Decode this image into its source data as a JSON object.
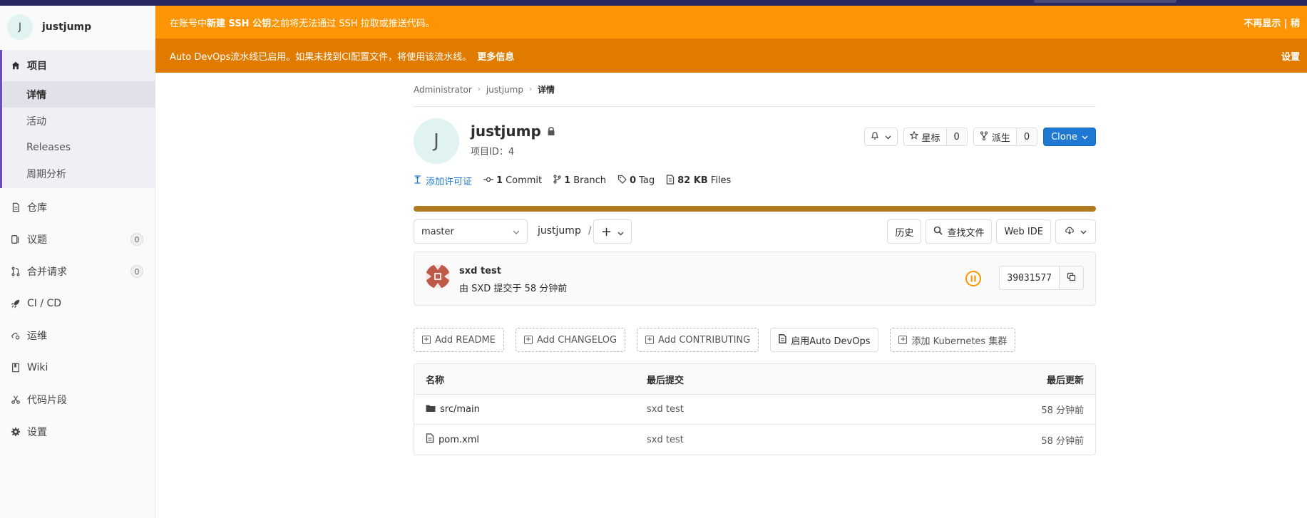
{
  "project": {
    "avatar_letter": "J",
    "name": "justjump",
    "id_label": "项目ID：4"
  },
  "sidebar": {
    "items": [
      {
        "label": "项目",
        "icon": "home-icon"
      },
      {
        "label": "仓库",
        "icon": "doc-icon"
      },
      {
        "label": "议题",
        "icon": "issues-icon",
        "count": "0"
      },
      {
        "label": "合并请求",
        "icon": "merge-icon",
        "count": "0"
      },
      {
        "label": "CI / CD",
        "icon": "rocket-icon"
      },
      {
        "label": "运维",
        "icon": "cloud-gear-icon"
      },
      {
        "label": "Wiki",
        "icon": "book-icon"
      },
      {
        "label": "代码片段",
        "icon": "scissors-icon"
      },
      {
        "label": "设置",
        "icon": "gear-icon"
      }
    ],
    "sub_items": [
      "详情",
      "活动",
      "Releases",
      "周期分析"
    ]
  },
  "banners": {
    "ssh_pre": "在账号中 ",
    "ssh_bold": "新建 SSH 公钥",
    "ssh_post": " 之前将无法通过 SSH 拉取或推送代码。",
    "ssh_right": "不再显示 | 稍",
    "devops_text": "Auto DevOps流水线已启用。如果未找到CI配置文件，将使用该流水线。",
    "devops_more": "更多信息",
    "devops_right": "设置"
  },
  "breadcrumb": [
    "Administrator",
    "justjump",
    "详情"
  ],
  "actions": {
    "star_label": "星标",
    "star_count": "0",
    "fork_label": "派生",
    "fork_count": "0",
    "clone_label": "Clone"
  },
  "stats": {
    "license": "添加许可证",
    "commits_count": "1",
    "commits_label": "Commit",
    "branches_count": "1",
    "branches_label": "Branch",
    "tags_count": "0",
    "tags_label": "Tag",
    "files_size": "82 KB",
    "files_label": "Files"
  },
  "language_bar": {
    "color": "#b07a1e",
    "fraction": 1.0
  },
  "toolbar": {
    "branch": "master",
    "path_root": "justjump",
    "path_sep": "/",
    "add_symbol": "+",
    "history": "历史",
    "find_file": "查找文件",
    "web_ide": "Web IDE"
  },
  "last_commit": {
    "title": "sxd test",
    "meta": "由 SXD 提交于 58 分钟前",
    "sha": "39031577",
    "pipeline_status_color": "#fc9403"
  },
  "suggestions": [
    {
      "label": "Add README",
      "style": "dashed",
      "icon": "plus-square-icon"
    },
    {
      "label": "Add CHANGELOG",
      "style": "dashed",
      "icon": "plus-square-icon"
    },
    {
      "label": "Add CONTRIBUTING",
      "style": "dashed",
      "icon": "plus-square-icon"
    },
    {
      "label": "启用Auto DevOps",
      "style": "solid",
      "icon": "doc-icon"
    },
    {
      "label": "添加 Kubernetes 集群",
      "style": "dashed",
      "icon": "plus-square-icon"
    }
  ],
  "file_table": {
    "headers": [
      "名称",
      "最后提交",
      "最后更新"
    ],
    "rows": [
      {
        "icon": "folder-icon",
        "name": "src/main",
        "commit": "sxd test",
        "updated": "58 分钟前"
      },
      {
        "icon": "file-icon",
        "name": "pom.xml",
        "commit": "sxd test",
        "updated": "58 分钟前"
      }
    ]
  },
  "colors": {
    "banner_ssh": "#fc9403",
    "banner_devops": "#e07b00",
    "primary_blue": "#1f78d1",
    "sidebar_active_border": "#6b4fbb"
  }
}
